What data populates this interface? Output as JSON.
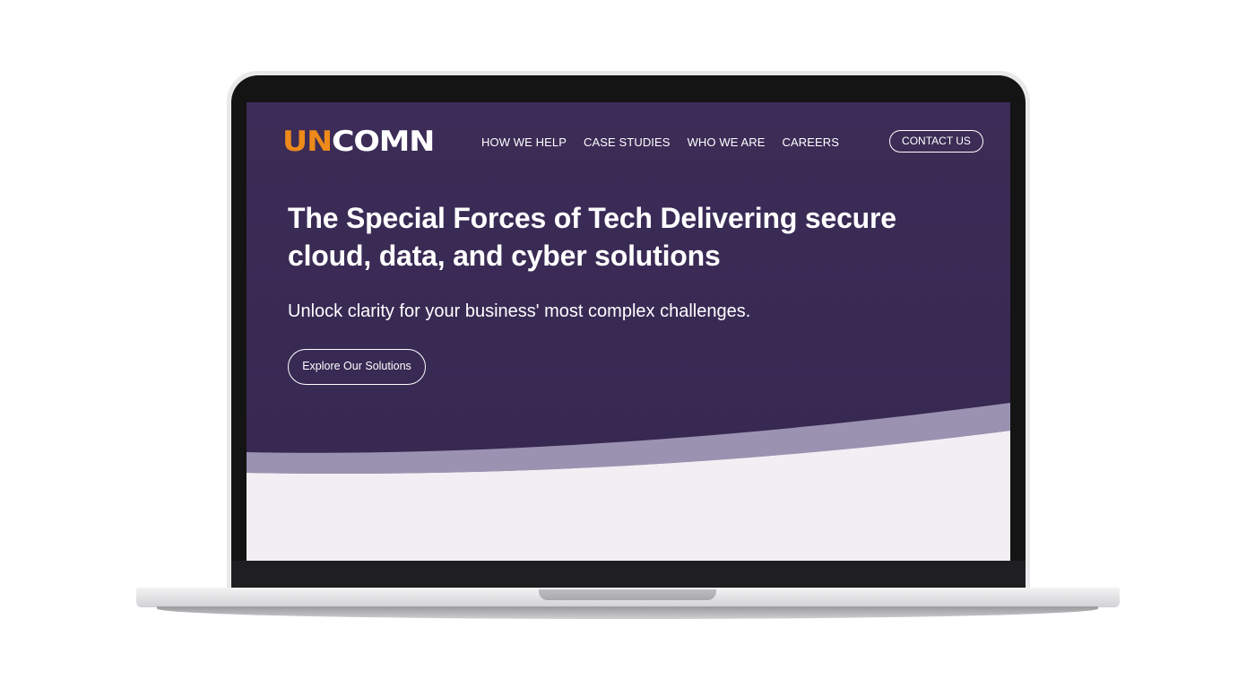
{
  "brand": {
    "logo_accent": "UN",
    "logo_rest": "COMN",
    "accent_color": "#ee8a1a"
  },
  "nav": {
    "items": [
      {
        "label": "HOW WE HELP"
      },
      {
        "label": "CASE STUDIES"
      },
      {
        "label": "WHO WE ARE"
      },
      {
        "label": "CAREERS"
      }
    ],
    "contact_label": "CONTACT US"
  },
  "hero": {
    "headline_line1": "The Special Forces of Tech Delivering secure",
    "headline_line2": "cloud, data, and cyber solutions",
    "subheadline": "Unlock clarity for your business' most complex challenges.",
    "cta_label": "Explore Our Solutions",
    "background_color": "#3a2a55",
    "wave_color": "#9b92b1"
  }
}
